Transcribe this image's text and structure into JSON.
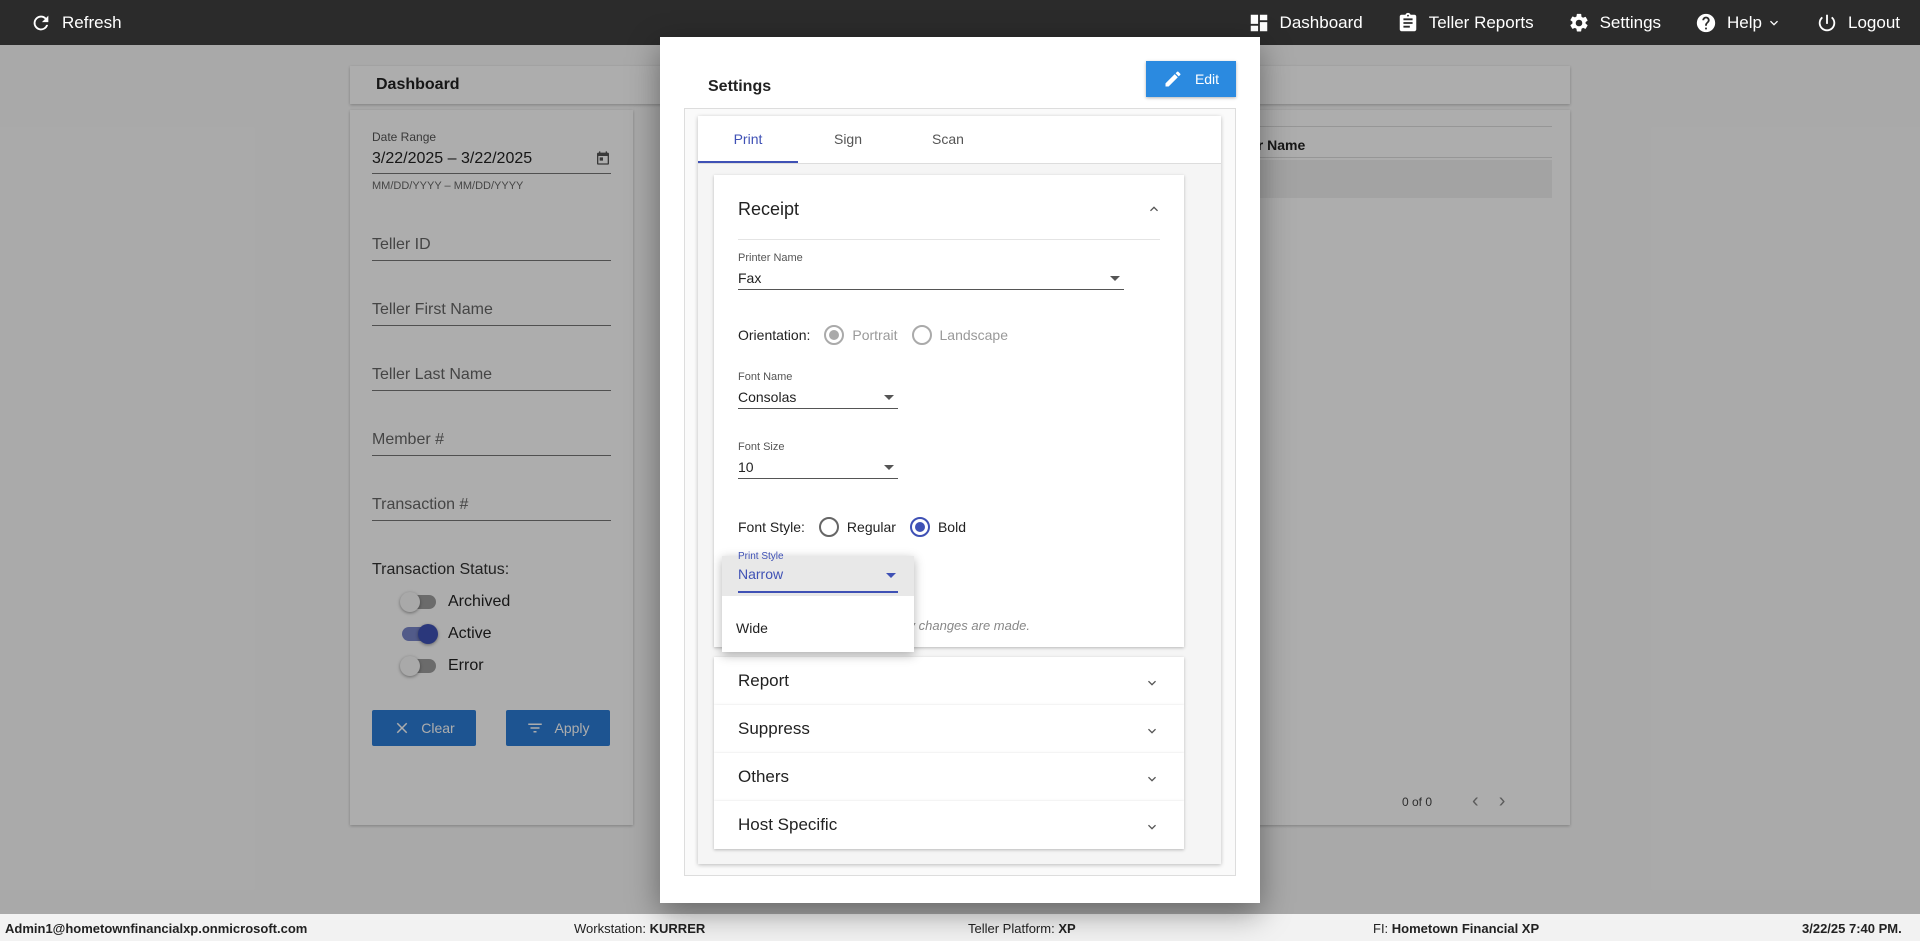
{
  "topbar": {
    "refresh": "Refresh",
    "dashboard": "Dashboard",
    "teller_reports": "Teller Reports",
    "settings": "Settings",
    "help": "Help",
    "logout": "Logout"
  },
  "dashboard": {
    "title": "Dashboard",
    "date_range_label": "Date Range",
    "date_range_value": "3/22/2025 – 3/22/2025",
    "date_range_hint": "MM/DD/YYYY – MM/DD/YYYY",
    "teller_id": "Teller ID",
    "teller_first_name": "Teller First Name",
    "teller_last_name": "Teller Last Name",
    "member_no": "Member #",
    "transaction_no": "Transaction #",
    "status_title": "Transaction Status:",
    "statuses": [
      {
        "label": "Archived",
        "on": false
      },
      {
        "label": "Active",
        "on": true
      },
      {
        "label": "Error",
        "on": false
      }
    ],
    "clear_label": "Clear",
    "apply_label": "Apply",
    "results_header": "er Name",
    "pager_text": "0 of 0"
  },
  "dialog": {
    "title": "Settings",
    "edit_label": "Edit",
    "tabs": [
      "Print",
      "Sign",
      "Scan"
    ],
    "active_tab": "Print",
    "receipt": {
      "title": "Receipt",
      "printer_name_label": "Printer Name",
      "printer_name_value": "Fax",
      "orientation_label": "Orientation:",
      "orientation_options": [
        "Portrait",
        "Landscape"
      ],
      "orientation_selected": "Portrait",
      "font_name_label": "Font Name",
      "font_name_value": "Consolas",
      "font_size_label": "Font Size",
      "font_size_value": "10",
      "font_style_label": "Font Style:",
      "font_style_options": [
        "Regular",
        "Bold"
      ],
      "font_style_selected": "Bold",
      "print_style_label": "Print Style",
      "print_style_options": [
        "Narrow",
        "Wide"
      ],
      "print_style_selected": "Narrow",
      "note": "*Restart eReceipts client if any changes are made."
    },
    "sections": [
      "Report",
      "Suppress",
      "Others",
      "Host Specific"
    ]
  },
  "statusbar": {
    "user": "Admin1@hometownfinancialxp.onmicrosoft.com",
    "workstation_label": "Workstation:",
    "workstation_value": "KURRER",
    "platform_label": "Teller Platform:",
    "platform_value": "XP",
    "fi_label": "FI:",
    "fi_value": "Hometown Financial XP",
    "datetime": "3/22/25 7:40 PM."
  },
  "colors": {
    "accent": "#3f51b5",
    "button_blue": "#2b7dd6",
    "topbar": "#2b2b2b"
  }
}
